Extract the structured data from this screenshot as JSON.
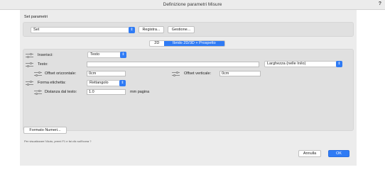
{
  "window": {
    "title": "Definizione parametri Misure",
    "help_glyph": "?"
  },
  "set_parametri": {
    "label": "Set parametri",
    "selected": "Set",
    "registra_label": "Registra...",
    "gestione_label": "Gestione..."
  },
  "tabs": [
    {
      "label": "2D"
    },
    {
      "label": "Ibrido 2D/3D + Prospetto"
    }
  ],
  "form": {
    "inserisci_label": "Inserisci:",
    "inserisci_value": "Testo",
    "testo_label": "Testo:",
    "testo_value": "",
    "larghezza_selected": "Larghezza (nelle In/io)",
    "offset_oriz_label": "Offset orizzontale:",
    "offset_oriz_value": "0cm",
    "offset_vert_label": "Offset verticale:",
    "offset_vert_value": "0cm",
    "forma_label": "Forma etichetta:",
    "forma_value": "Rettangolo",
    "distanza_label": "Distanza dal testo:",
    "distanza_value": "1.0",
    "distanza_unit": "mm pagina"
  },
  "formato_numeri_label": "Formato Numeri...",
  "help_text": "Per visualizzare l'Aiuto, premi F1 e fai clic sull'icona ?",
  "footer": {
    "annulla_label": "Annulla",
    "ok_label": "OK"
  },
  "colors": {
    "accent": "#2f7bf5",
    "window_bg": "#ececec",
    "group_bg": "#e0e0e0"
  }
}
